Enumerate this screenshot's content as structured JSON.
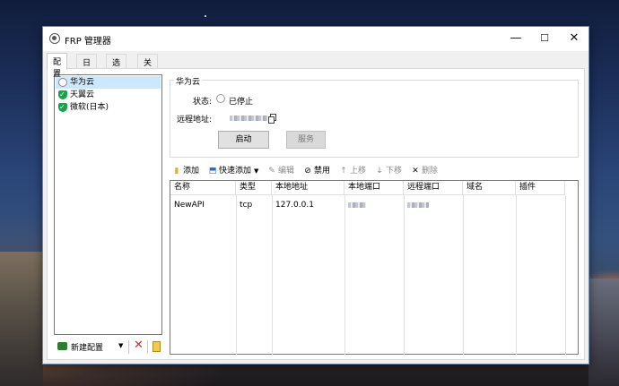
{
  "window": {
    "title": "FRP 管理器",
    "min": "—",
    "max": "☐",
    "close": "✕"
  },
  "tabs": [
    "配置",
    "日志",
    "选项",
    "关于"
  ],
  "configs": [
    {
      "name": "华为云",
      "icon": "stopped-circle-icon"
    },
    {
      "name": "天翼云",
      "icon": "green-shield-check-icon"
    },
    {
      "name": "微软(日本)",
      "icon": "green-shield-check-icon"
    }
  ],
  "left_toolbar": {
    "new_config": "新建配置",
    "dropdown": "▼",
    "delete": "✕"
  },
  "detail": {
    "group_title": "华为云",
    "status_label": "状态:",
    "status_value": "已停止",
    "remote_label": "远程地址:",
    "start_button": "启动",
    "service_button": "服务"
  },
  "proxy_toolbar": {
    "add": "添加",
    "quick_add": "快速添加",
    "dropdown": "▼",
    "edit": "编辑",
    "disable": "禁用",
    "move_up": "上移",
    "move_down": "下移",
    "delete": "删除"
  },
  "table": {
    "columns": [
      "名称",
      "类型",
      "本地地址",
      "本地端口",
      "远程端口",
      "域名",
      "插件"
    ],
    "rows": [
      {
        "name": "NewAPI",
        "type": "tcp",
        "local_address": "127.0.0.1"
      }
    ]
  }
}
